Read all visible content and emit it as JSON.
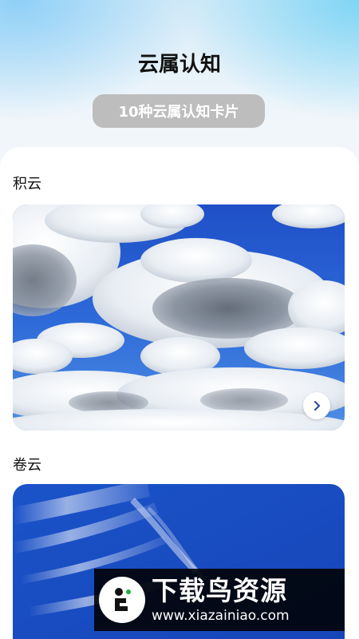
{
  "header": {
    "title": "云属认知",
    "subtitle": "10种云属认知卡片"
  },
  "cards": [
    {
      "label": "积云",
      "image": "cumulus-clouds-photo",
      "arrow_icon": "chevron-right-icon"
    },
    {
      "label": "卷云",
      "image": "cirrus-clouds-photo"
    }
  ],
  "watermark": {
    "name": "下载鸟资源",
    "url": "www.xiazainiao.com",
    "logo": "bird-logo-icon"
  },
  "colors": {
    "pill_bg": "#bdbdbd",
    "sky_blue": "#2b5fcf",
    "header_gradient": "#8fd0f7"
  }
}
